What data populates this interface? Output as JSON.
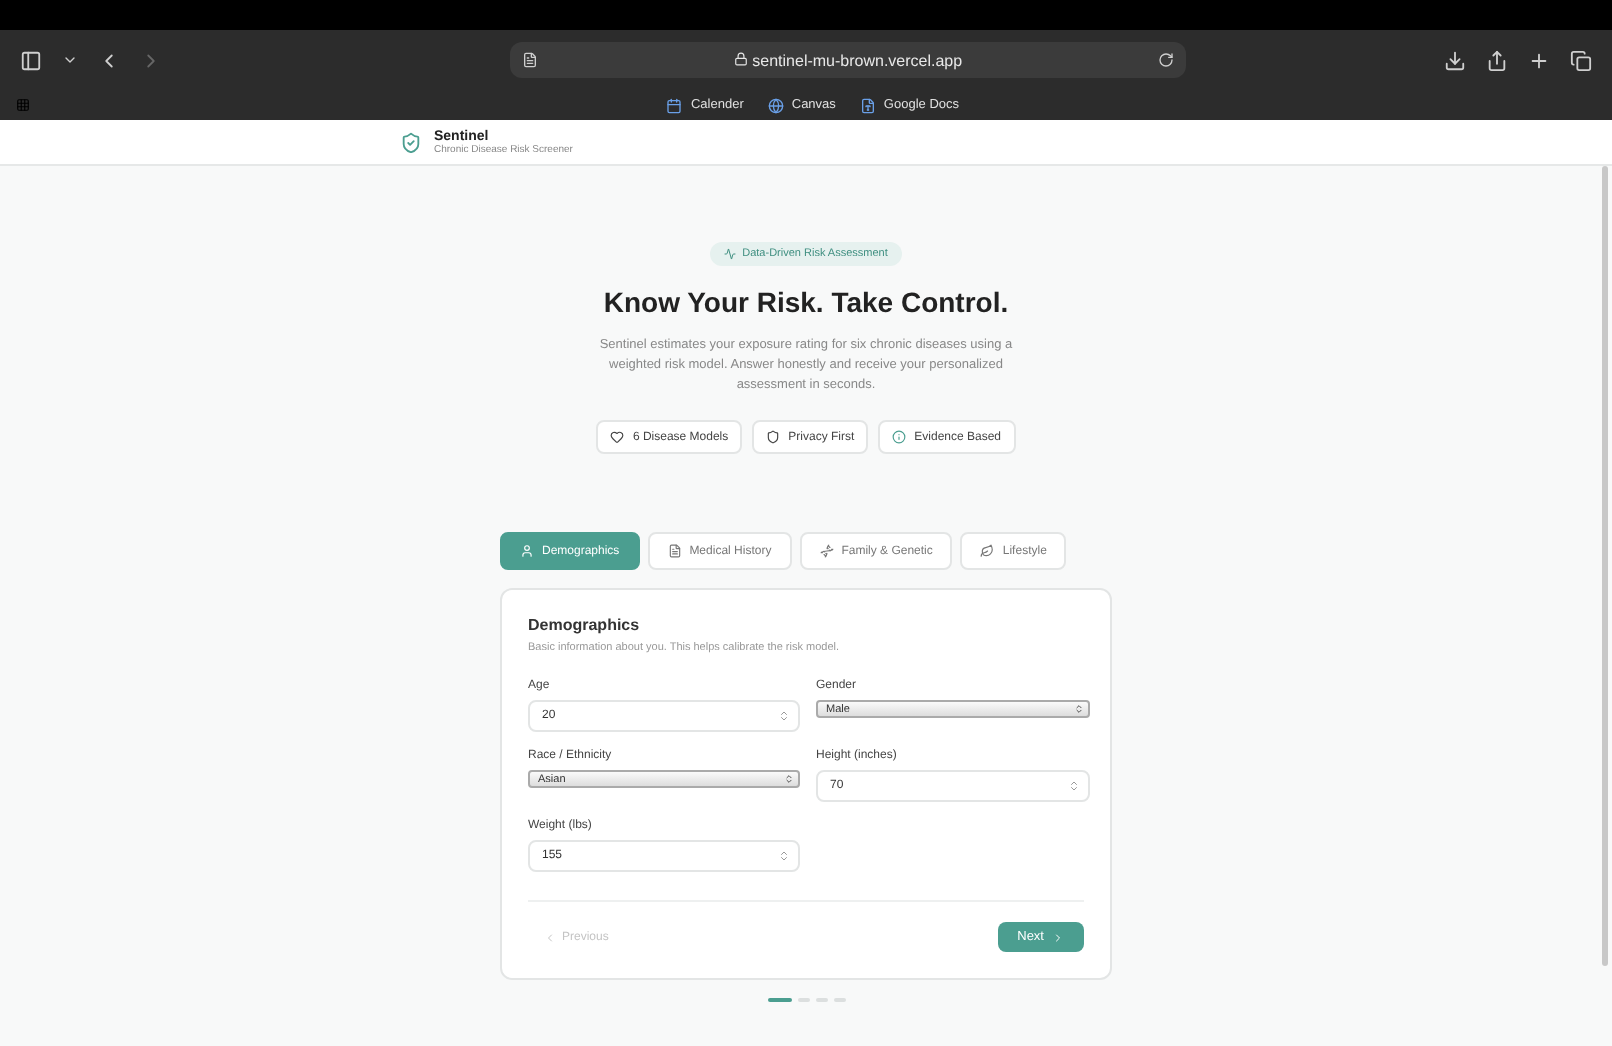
{
  "browser": {
    "url": "sentinel-mu-brown.vercel.app",
    "bookmarks": [
      "Calender",
      "Canvas",
      "Google Docs"
    ]
  },
  "header": {
    "title": "Sentinel",
    "subtitle": "Chronic Disease Risk Screener"
  },
  "hero": {
    "badge": "Data-Driven Risk Assessment",
    "title": "Know Your Risk. Take Control.",
    "description": "Sentinel estimates your exposure rating for six chronic diseases using a weighted risk model. Answer honestly and receive your personalized assessment in seconds.",
    "pills": [
      {
        "kind": "heart",
        "label": "6 Disease Models"
      },
      {
        "kind": "shield",
        "label": "Privacy First"
      },
      {
        "kind": "info",
        "label": "Evidence Based"
      }
    ]
  },
  "tabs": [
    {
      "label": "Demographics",
      "selected": true
    },
    {
      "label": "Medical History",
      "selected": false
    },
    {
      "label": "Family & Genetic",
      "selected": false
    },
    {
      "label": "Lifestyle",
      "selected": false
    }
  ],
  "form": {
    "title": "Demographics",
    "description": "Basic information about you. This helps calibrate the risk model.",
    "fields": [
      {
        "label": "Age",
        "kind": "number",
        "value": "20"
      },
      {
        "label": "Gender",
        "kind": "select",
        "value": "Male"
      },
      {
        "label": "Race / Ethnicity",
        "kind": "select",
        "value": "Asian"
      },
      {
        "label": "Height (inches)",
        "kind": "number",
        "value": "70"
      },
      {
        "label": "Weight (lbs)",
        "kind": "number",
        "value": "155"
      }
    ],
    "previous": {
      "label": "Previous",
      "disabled": true
    },
    "next": {
      "label": "Next",
      "disabled": false
    }
  },
  "steps": [
    {
      "selected": true
    },
    {
      "selected": false
    },
    {
      "selected": false
    },
    {
      "selected": false
    }
  ]
}
